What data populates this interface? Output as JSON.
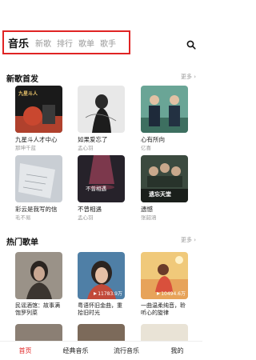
{
  "header": {
    "tabs": [
      {
        "label": "音乐",
        "active": true
      },
      {
        "label": "新歌",
        "active": false
      },
      {
        "label": "排行",
        "active": false
      },
      {
        "label": "歌单",
        "active": false
      },
      {
        "label": "歌手",
        "active": false
      }
    ],
    "search_icon": "search-icon"
  },
  "new_songs": {
    "title": "新歌首发",
    "more": "更多 ›",
    "items": [
      {
        "title": "九星斗人才中心",
        "artist": "那坤千蓝",
        "cover_text": "九星斗人"
      },
      {
        "title": "如果爱忘了",
        "artist": "孟心羽",
        "cover_text": ""
      },
      {
        "title": "心有所向",
        "artist": "亿喜",
        "cover_text": ""
      },
      {
        "title": "彩云是我写的信",
        "artist": "毛不易",
        "cover_text": ""
      },
      {
        "title": "不曾相遇",
        "artist": "孟心羽",
        "cover_text": "不曾相遇"
      },
      {
        "title": "遗憾",
        "artist": "张韶涵",
        "cover_text": "遗忘天堂"
      }
    ]
  },
  "hot_playlists": {
    "title": "热门歌单",
    "more": "更多 ›",
    "items": [
      {
        "title": "民谣酒馆：故事满饱罗列菜",
        "plays": ""
      },
      {
        "title": "粤语怀旧金曲，重拾旧时光",
        "plays": "11783.9万"
      },
      {
        "title": "一曲温柔纯音，聆听心的旋律",
        "plays": "10494.6万"
      }
    ]
  },
  "bottom_nav": {
    "items": [
      {
        "label": "首页",
        "active": true
      },
      {
        "label": "经典音乐",
        "active": false
      },
      {
        "label": "流行音乐",
        "active": false
      },
      {
        "label": "我的",
        "active": false
      }
    ]
  },
  "colors": {
    "accent": "#e02424"
  }
}
